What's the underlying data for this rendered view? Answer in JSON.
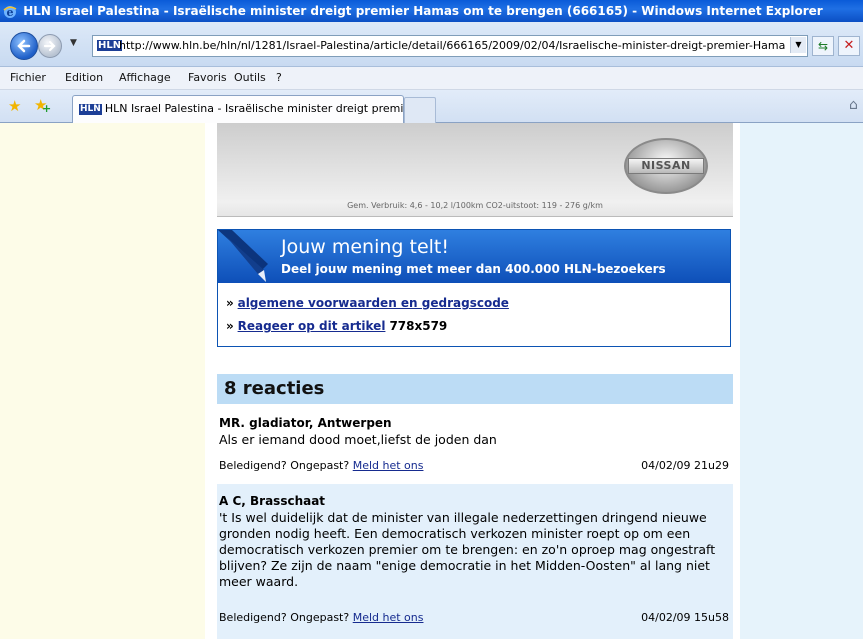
{
  "window": {
    "title": "HLN Israel Palestina - Israëlische minister dreigt premier Hamas om te brengen (666165) - Windows Internet Explorer"
  },
  "address_bar": {
    "favicon": "HLN",
    "url": "http://www.hln.be/hln/nl/1281/Israel-Palestina/article/detail/666165/2009/02/04/Israelische-minister-dreigt-premier-Hamas-om"
  },
  "menu": {
    "items": [
      "Fichier",
      "Edition",
      "Affichage",
      "Favoris",
      "Outils",
      "?"
    ]
  },
  "tabs": [
    {
      "favicon": "HLN",
      "label": "HLN Israel Palestina - Israëlische minister dreigt premi..."
    }
  ],
  "ad": {
    "brand": "NISSAN",
    "disclaimer": "Gem. Verbruik: 4,6 - 10,2 l/100km CO2-uitstoot: 119 - 276 g/km"
  },
  "opinion_box": {
    "title": "Jouw mening telt!",
    "subtitle": "Deel jouw mening met meer dan 400.000 HLN-bezoekers",
    "arrow": "»",
    "link_terms": "algemene voorwaarden en gedragscode",
    "link_react": "Reageer op dit artikel",
    "dimension_note": "778x579"
  },
  "reactions": {
    "header": "8 reacties",
    "comments": [
      {
        "author": "MR. gladiator, Antwerpen",
        "body": "Als er iemand dood moet,liefst de joden dan",
        "report_prefix": "Beledigend? Ongepast?",
        "report_link": "Meld het ons",
        "date": "04/02/09 21u29"
      },
      {
        "author": "A C, Brasschaat",
        "body": "'t Is wel duidelijk dat de minister van illegale nederzettingen dringend nieuwe gronden nodig heeft. Een democratisch verkozen minister roept op om een democratisch verkozen premier om te brengen: en zo'n oproep mag ongestraft blijven? Ze zijn de naam \"enige democratie in het Midden-Oosten\" al lang niet meer waard.",
        "report_prefix": "Beledigend? Ongepast?",
        "report_link": "Meld het ons",
        "date": "04/02/09 15u58"
      }
    ]
  },
  "icons": {
    "titlebar": "ie-logo-icon",
    "back": "back-arrow-icon",
    "forward": "forward-arrow-icon",
    "refresh": "refresh-icon",
    "stop": "stop-icon",
    "favorites": "favorites-star-icon",
    "add_favorite": "add-favorite-icon",
    "home": "home-icon",
    "pen": "pen-icon"
  },
  "colors": {
    "title_bar": "#0a5bd8",
    "opinion_header": "#1565c8",
    "reacties_header": "#bcdcf5",
    "link": "#162b8f",
    "left_column": "#fdfce8",
    "right_column": "#e6f3fb"
  }
}
